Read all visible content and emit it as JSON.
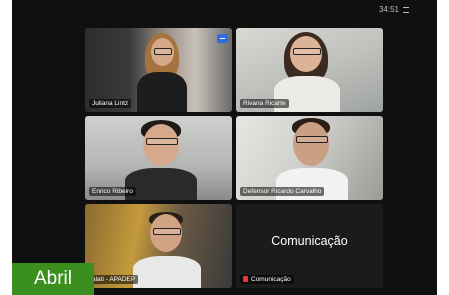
{
  "topbar": {
    "timer": "34:51"
  },
  "participants": [
    {
      "name": "Juliana Lintz",
      "pinned": true,
      "speaking": false
    },
    {
      "name": "Rivana Ricarte",
      "pinned": false,
      "speaking": true
    },
    {
      "name": "Enrico Ribeiro",
      "pinned": false,
      "speaking": false
    },
    {
      "name": "Defensor Ricardo Carvalho",
      "pinned": false,
      "speaking": false
    },
    {
      "name": "alati - APADEP",
      "pinned": false,
      "speaking": false
    },
    {
      "name": "Comunicação",
      "display_text": "Comunicação",
      "muted": true,
      "video_off": true
    }
  ],
  "overlay": {
    "month": "Abril"
  },
  "colors": {
    "speaking_border": "#2fbf48",
    "overlay_bg": "#3a8f1f",
    "pin_badge": "#2d6fe0",
    "mute": "#e53935"
  }
}
